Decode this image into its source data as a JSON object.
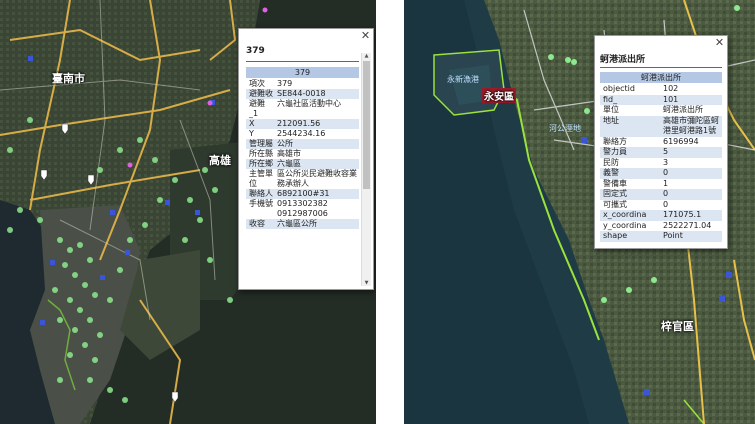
{
  "left_map": {
    "city_labels": [
      "臺南市",
      "高雄"
    ],
    "popup": {
      "title": "379",
      "header": "379",
      "rows": [
        {
          "key": "項次",
          "value": "379"
        },
        {
          "key": "避難收",
          "value": "SE844-0018"
        },
        {
          "key": "避難_1",
          "value": "六龜社區活動中心"
        },
        {
          "key": "X",
          "value": "212091.56"
        },
        {
          "key": "Y",
          "value": "2544234.16"
        },
        {
          "key": "管理屬",
          "value": "公所"
        },
        {
          "key": "所在縣",
          "value": "高雄市"
        },
        {
          "key": "所在鄉",
          "value": "六龜區"
        },
        {
          "key": "主管單位",
          "value": "區公所災民避難收容業務承辦人"
        },
        {
          "key": "聯絡人",
          "value": "6892100#31"
        },
        {
          "key": "手機號",
          "value": "0913302382 0912987006"
        },
        {
          "key": "收容",
          "value": "六龜區公所"
        }
      ]
    }
  },
  "right_map": {
    "place_labels": [
      "永安區",
      "梓官區"
    ],
    "small_labels": [
      "永新漁港",
      "河公溼地"
    ],
    "popup": {
      "title": "蚵港派出所",
      "header": "蚵港派出所",
      "rows": [
        {
          "key": "objectid",
          "value": "102"
        },
        {
          "key": "fid_",
          "value": "101"
        },
        {
          "key": "單位",
          "value": "蚵港派出所"
        },
        {
          "key": "地址",
          "value": "高雄市彌陀區蚵港里蚵港路1號"
        },
        {
          "key": "聯絡方",
          "value": "6196994"
        },
        {
          "key": "警力員",
          "value": "5"
        },
        {
          "key": "民防",
          "value": "3"
        },
        {
          "key": "義警",
          "value": "0"
        },
        {
          "key": "警備車",
          "value": "1"
        },
        {
          "key": "固定式",
          "value": "0"
        },
        {
          "key": "可攜式",
          "value": "0"
        },
        {
          "key": "x_coordina",
          "value": "171075.1"
        },
        {
          "key": "y_coordina",
          "value": "2522271.04"
        },
        {
          "key": "shape",
          "value": "Point"
        }
      ]
    }
  },
  "colors": {
    "popup_header": "#b4c8e6",
    "row_stripe": "#dce6f3",
    "shelter_marker": "#7fe07f",
    "police_marker": "#3b55d8",
    "highway": "#e8b84a",
    "coast_highlight": "#9ae23c"
  },
  "icons": [
    "close-icon",
    "shelter-marker-icon",
    "police-station-marker-icon",
    "route-shield-icon",
    "scroll-up-arrow-icon",
    "scroll-down-arrow-icon"
  ]
}
